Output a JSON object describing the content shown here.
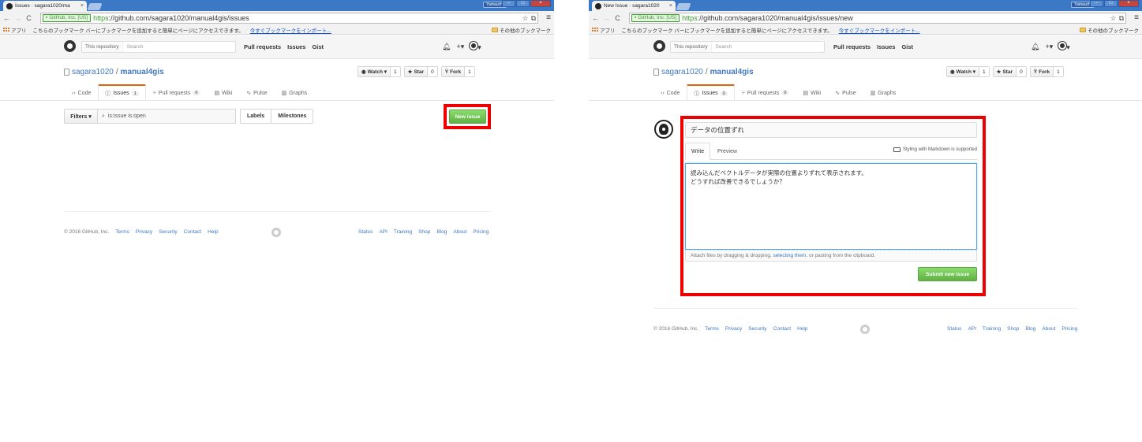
{
  "colors": {
    "chrome_titlebar": "#3b78c6",
    "github_link": "#4078c0",
    "selected_tab_accent": "#e36209",
    "primary_green": "#60b044",
    "highlight_red": "#ee0000"
  },
  "shared": {
    "bookmarks": {
      "apps_label": "アプリ",
      "message": "こちらのブックマーク バーにブックマークを追加すると簡単にページにアクセスできます。",
      "import_link": "今すぐブックマークをインポート...",
      "other_folder": "その他のブックマーク"
    },
    "ev_badge": "GitHub, Inc. [US]",
    "url_scheme": "https",
    "window_profile": "Yamauchi",
    "header": {
      "search_scope": "This repository",
      "search_placeholder": "Search",
      "nav": [
        "Pull requests",
        "Issues",
        "Gist"
      ],
      "bell_icon": "bell-icon",
      "plus_label": "+▾",
      "avatar_caret": "▾"
    },
    "repo": {
      "owner": "sagara1020",
      "separator": "/",
      "name": "manual4gis"
    },
    "actions": {
      "watch_label": "Watch ▾",
      "watch_count": "1",
      "star_label": "Star",
      "star_count": "0",
      "fork_label": "Fork",
      "fork_count": "1"
    },
    "reponav": {
      "code": "Code",
      "issues": "Issues",
      "pull_requests": "Pull requests",
      "pulls_count": "0",
      "wiki": "Wiki",
      "pulse": "Pulse",
      "graphs": "Graphs"
    },
    "footer": {
      "copyright": "© 2016 GitHub, Inc.",
      "left_links": [
        "Terms",
        "Privacy",
        "Security",
        "Contact",
        "Help"
      ],
      "right_links": [
        "Status",
        "API",
        "Training",
        "Shop",
        "Blog",
        "About",
        "Pricing"
      ]
    }
  },
  "left": {
    "tab_title": "Issues · sagara1020/ma",
    "url_path": "://github.com/sagara1020/manual4gis/issues",
    "issues_count": "1",
    "filters_label": "Filters ▾",
    "filter_query": "is:issue is:open",
    "labels_button": "Labels",
    "milestones_button": "Milestones",
    "new_issue_button": "New issue"
  },
  "right": {
    "tab_title": "New Issue · sagara1020",
    "url_path": "://github.com/sagara1020/manual4gis/issues/new",
    "issues_count": "0",
    "issue_title_value": "データの位置ずれ",
    "write_tab": "Write",
    "preview_tab": "Preview",
    "markdown_note": "Styling with Markdown is supported",
    "body_line_1": "読み込んだベクトルデータが実際の位置よりずれて表示されます。",
    "body_line_2": "どうすれば改善できるでしょうか？",
    "attach_prefix": "Attach files by dragging & dropping,",
    "attach_link": "selecting them",
    "attach_suffix": ", or pasting from the clipboard.",
    "submit_button": "Submit new issue"
  }
}
